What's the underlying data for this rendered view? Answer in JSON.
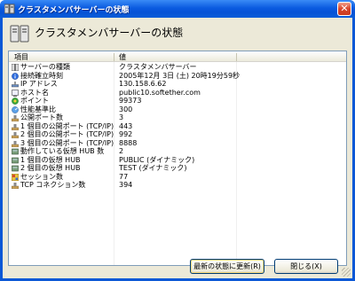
{
  "window": {
    "title": "クラスタメンバサーバーの状態",
    "close_glyph": "✕",
    "header_title": "クラスタメンバサーバーの状態"
  },
  "table": {
    "columns": [
      "項目",
      "値"
    ],
    "rows": [
      {
        "icon": "server-icon",
        "name": "サーバーの種類",
        "value": "クラスタメンバサーバー"
      },
      {
        "icon": "info-icon",
        "name": "接続確立時刻",
        "value": "2005年12月 3日 (土) 20時19分59秒"
      },
      {
        "icon": "network-icon",
        "name": "IP アドレス",
        "value": "130.158.6.62"
      },
      {
        "icon": "host-icon",
        "name": "ホスト名",
        "value": "public10.softether.com"
      },
      {
        "icon": "points-icon",
        "name": "ポイント",
        "value": "99373"
      },
      {
        "icon": "performance-icon",
        "name": "性能基準比",
        "value": "300"
      },
      {
        "icon": "port-icon",
        "name": "公開ポート数",
        "value": "3"
      },
      {
        "icon": "port-icon",
        "name": "1 個目の公開ポート (TCP/IP)",
        "value": "443"
      },
      {
        "icon": "port-icon",
        "name": "2 個目の公開ポート (TCP/IP)",
        "value": "992"
      },
      {
        "icon": "port-icon",
        "name": "3 個目の公開ポート (TCP/IP)",
        "value": "8888"
      },
      {
        "icon": "hub-icon",
        "name": "動作している仮想 HUB 数",
        "value": "2"
      },
      {
        "icon": "hub-icon",
        "name": "1 個目の仮想 HUB",
        "value": "PUBLIC (ダイナミック)"
      },
      {
        "icon": "hub-icon",
        "name": "2 個目の仮想 HUB",
        "value": "TEST (ダイナミック)"
      },
      {
        "icon": "session-icon",
        "name": "セッション数",
        "value": "77"
      },
      {
        "icon": "port-icon",
        "name": "TCP コネクション数",
        "value": "394"
      }
    ]
  },
  "buttons": {
    "refresh": "最新の状態に更新(R)",
    "close": "閉じる(X)"
  },
  "colors": {
    "titlebar": "#0b5be0",
    "client": "#ece9d8",
    "border": "#7f9db9"
  }
}
